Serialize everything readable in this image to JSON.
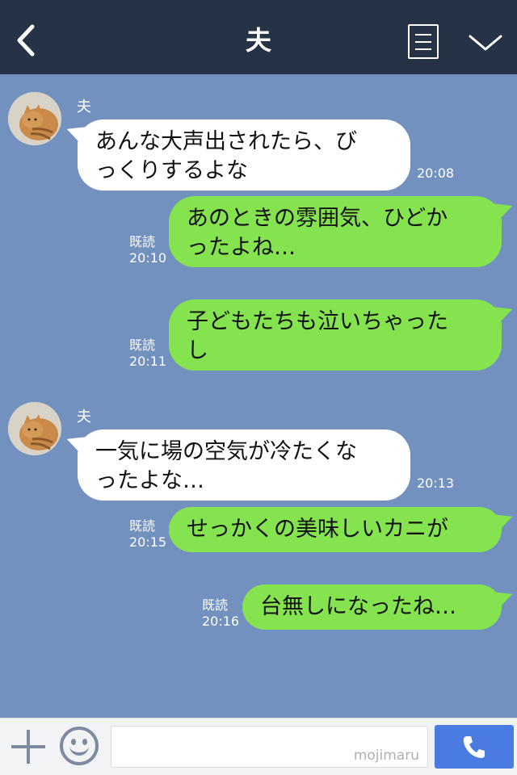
{
  "header": {
    "title": "夫"
  },
  "messages": [
    {
      "sender": "夫",
      "text": "あんな大声出されたら、び\nっくりするよな",
      "time": "20:08"
    },
    {
      "read": "既読",
      "text": "あのときの雰囲気、ひどか\nったよね…",
      "time": "20:10"
    },
    {
      "read": "既読",
      "text": "子どもたちも泣いちゃった\nし",
      "time": "20:11"
    },
    {
      "sender": "夫",
      "text": "一気に場の空気が冷たくな\nったよな…",
      "time": "20:13"
    },
    {
      "read": "既読",
      "text": "せっかくの美味しいカニが",
      "time": "20:15"
    },
    {
      "read": "既読",
      "text": "台無しになったね…",
      "time": "20:16"
    }
  ],
  "footer": {
    "watermark": "mojimaru"
  },
  "colors": {
    "background": "#7291be",
    "header": "#263246",
    "outgoing": "#84e34e",
    "incoming": "#ffffff",
    "call_button": "#4a7be1"
  },
  "icons": {
    "back": "chevron-left-icon",
    "menu": "document-menu-icon",
    "collapse": "chevron-down-icon",
    "add": "plus-icon",
    "emoji": "smiley-icon",
    "call": "phone-icon"
  }
}
